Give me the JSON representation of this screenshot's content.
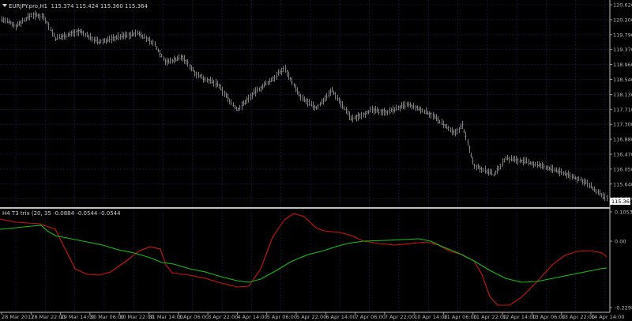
{
  "main_chart": {
    "title": "EURJPY.pro,H1",
    "ohlc": "115.374 115.424 115.360 115.364",
    "price_axis": [
      "120.620",
      "120.200",
      "119.790",
      "119.370",
      "118.960",
      "118.540",
      "118.130",
      "117.710",
      "117.300",
      "116.880",
      "116.470",
      "116.050",
      "115.640",
      "115.220"
    ],
    "last_price": "115.364"
  },
  "indicator": {
    "title": "H4 T3 trix (20, 35",
    "values": "-0.0884 -0.0544 -0.0544",
    "axis": [
      "0.1053",
      "0.00",
      "-0.2298"
    ]
  },
  "time_axis": [
    "28 Mar 2017",
    "28 Mar 22:00",
    "29 Mar 14:00",
    "30 Mar 06:00",
    "30 Mar 22:00",
    "31 Mar 14:00",
    "3 Apr 06:00",
    "3 Apr 22:00",
    "4 Apr 14:00",
    "5 Apr 06:00",
    "5 Apr 22:00",
    "6 Apr 14:00",
    "7 Apr 06:00",
    "7 Apr 22:00",
    "10 Apr 14:00",
    "11 Apr 06:00",
    "11 Apr 22:00",
    "12 Apr 14:00",
    "13 Apr 06:00",
    "13 Apr 22:00",
    "14 Apr 14:00"
  ],
  "colors": {
    "background": "#000000",
    "grid": "#1f1f5a",
    "bars": "#8a8a8a",
    "red_line": "#d01010",
    "green_line": "#10c010",
    "text": "#c8c8c8"
  }
}
